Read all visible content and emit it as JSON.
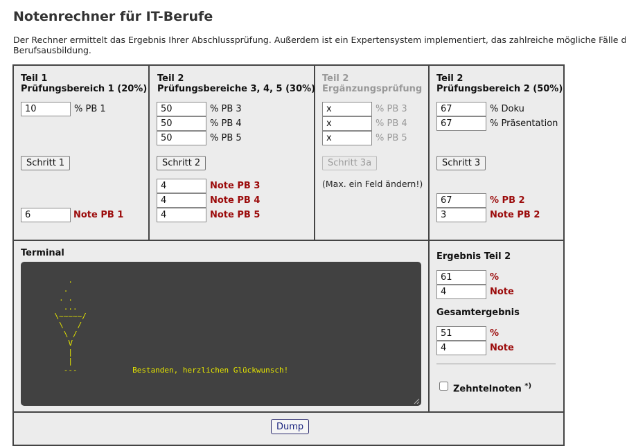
{
  "page": {
    "title": "Notenrechner für IT-Berufe",
    "intro_line1": "Der Rechner ermittelt das Ergebnis Ihrer Abschlussprüfung. Außerdem ist ein Expertensystem implementiert, das zahlreiche mögliche Fälle d",
    "intro_line2": "Berufsausbildung."
  },
  "teil1": {
    "header1": "Teil 1",
    "header2": "Prüfungsbereich 1 (20%)",
    "input_pb1": "10",
    "label_pb1": "% PB 1",
    "button": "Schritt 1",
    "note_value": "6",
    "note_label": "Note PB 1"
  },
  "teil2": {
    "header1": "Teil 2",
    "header2": "Prüfungsbereiche 3, 4, 5 (30%)",
    "inputs": [
      {
        "value": "50",
        "label": "% PB 3"
      },
      {
        "value": "50",
        "label": "% PB 4"
      },
      {
        "value": "50",
        "label": "% PB 5"
      }
    ],
    "button": "Schritt 2",
    "notes": [
      {
        "value": "4",
        "label": "Note PB 3"
      },
      {
        "value": "4",
        "label": "Note PB 4"
      },
      {
        "value": "4",
        "label": "Note PB 5"
      }
    ]
  },
  "ergaenzung": {
    "header1": "Teil 2",
    "header2": "Ergänzungsprüfung",
    "inputs": [
      {
        "value": "x",
        "label": "% PB 3"
      },
      {
        "value": "x",
        "label": "% PB 4"
      },
      {
        "value": "x",
        "label": "% PB 5"
      }
    ],
    "button": "Schritt 3a",
    "hint": "(Max. ein Feld ändern!)"
  },
  "pb2": {
    "header1": "Teil 2",
    "header2": "Prüfungsbereich 2 (50%)",
    "inputs": [
      {
        "value": "67",
        "label": "% Doku"
      },
      {
        "value": "67",
        "label": "% Präsentation"
      }
    ],
    "button": "Schritt 3",
    "result_percent": "67",
    "result_percent_label": "% PB 2",
    "result_note": "3",
    "result_note_label": "Note PB 2"
  },
  "terminal": {
    "title": "Terminal",
    "text": "       .\n      .\n     . .\n      ...\n    \\~~~~~/\n     \\   /\n      \\ /\n       V\n       |\n       |\n      ---            Bestanden, herzlichen Glückwunsch!"
  },
  "ergebnis": {
    "teil2_title": "Ergebnis Teil 2",
    "teil2_percent": "61",
    "teil2_note": "4",
    "gesamt_title": "Gesamtergebnis",
    "gesamt_percent": "51",
    "gesamt_note": "4",
    "percent_label": "%",
    "note_label": "Note",
    "zehntel_label": "Zehntelnoten",
    "zehntel_sup": "*)",
    "zehntel_checked": false
  },
  "footer": {
    "dump_button": "Dump"
  }
}
